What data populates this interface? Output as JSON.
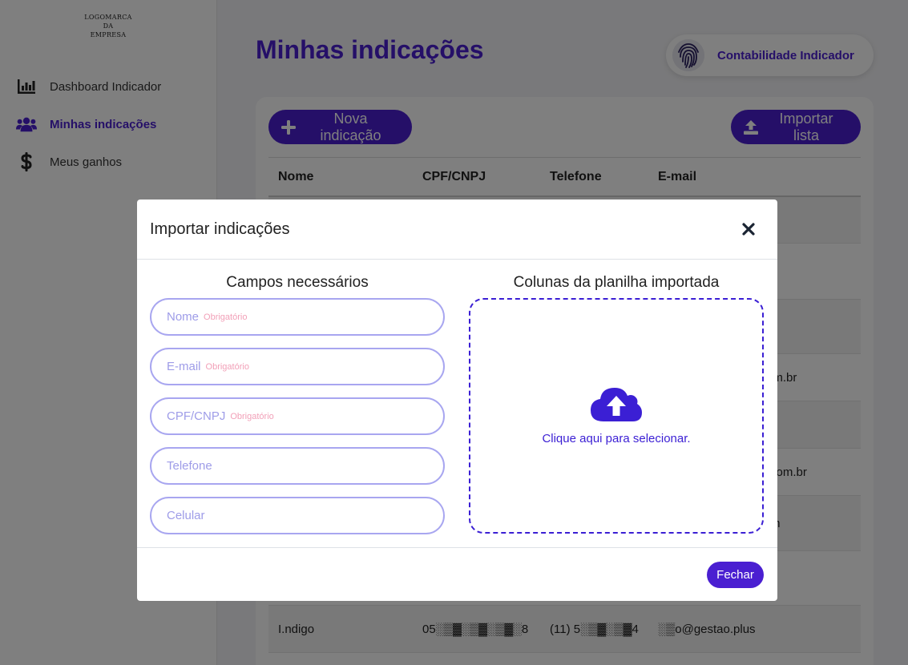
{
  "sidebar": {
    "logo_lines": [
      "LOGOMARCA",
      "DA",
      "EMPRESA"
    ],
    "items": [
      {
        "label": "Dashboard Indicador",
        "icon": "chart-bar-icon"
      },
      {
        "label": "Minhas indicações",
        "icon": "users-icon",
        "active": true
      },
      {
        "label": "Meus ganhos",
        "icon": "dollar-icon"
      }
    ]
  },
  "header": {
    "title": "Minhas indicações",
    "user_name": "Contabilidade Indicador",
    "user_icon": "fingerprint-icon"
  },
  "toolbar": {
    "new_label": "Nova indicação",
    "import_label": "Importar lista"
  },
  "table": {
    "columns": [
      "Nome",
      "CPF/CNPJ",
      "Telefone",
      "E-mail"
    ],
    "visible_fragments": {
      "row1_email": "n",
      "row4_email": "i.com.br",
      "row6_email": "tal.com.br",
      "row7_email": ".com"
    },
    "last_row": {
      "nome": "I.ndigo",
      "cpf": "05░▒▓░▒▓░▒▓░8",
      "telefone": "(11) 5░▒▓░▒▓4",
      "email": "░▒o@gestao.plus"
    }
  },
  "modal": {
    "title": "Importar indicações",
    "left_title": "Campos necessários",
    "right_title": "Colunas da planilha importada",
    "fields": [
      {
        "placeholder": "Nome",
        "required": "Obrigatório"
      },
      {
        "placeholder": "E-mail",
        "required": "Obrigatório"
      },
      {
        "placeholder": "CPF/CNPJ",
        "required": "Obrigatório"
      },
      {
        "placeholder": "Telefone",
        "required": ""
      },
      {
        "placeholder": "Celular",
        "required": ""
      }
    ],
    "upload_hint": "Clique aqui para selecionar.",
    "close_label": "Fechar"
  },
  "colors": {
    "primary": "#4a1fd1",
    "dropzone": "#3b1fd4",
    "field_border": "#a8a6f0",
    "required": "#f2a0b8"
  }
}
